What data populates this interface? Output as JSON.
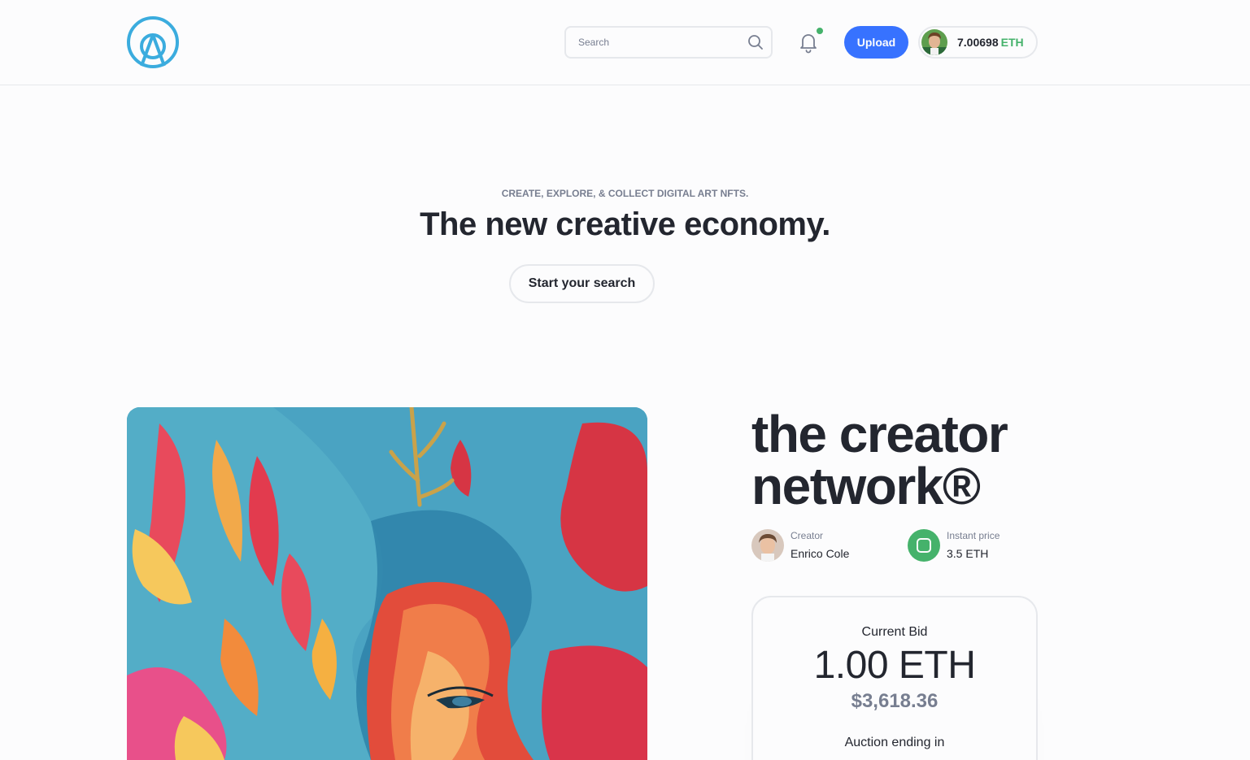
{
  "header": {
    "search_placeholder": "Search",
    "upload_label": "Upload",
    "wallet": {
      "balance": "7.00698",
      "currency": "ETH"
    },
    "notification_dot_color": "#45b26b",
    "accent_color": "#3772ff"
  },
  "hero": {
    "subtitle": "CREATE, EXPLORE, & COLLECT DIGITAL ART NFTS.",
    "title": "The new creative economy.",
    "cta_label": "Start your search"
  },
  "item": {
    "title_line1": "the creator",
    "title_line2": "network®",
    "creator_label": "Creator",
    "creator_name": "Enrico Cole",
    "instant_price_label": "Instant price",
    "instant_price_value": "3.5 ETH"
  },
  "bid": {
    "label": "Current Bid",
    "value": "1.00 ETH",
    "usd": "$3,618.36",
    "auction_label": "Auction ending in"
  },
  "icons": {
    "logo": "logo-icon",
    "search": "search-icon",
    "notification": "bell-icon",
    "instant_price": "square-icon"
  }
}
